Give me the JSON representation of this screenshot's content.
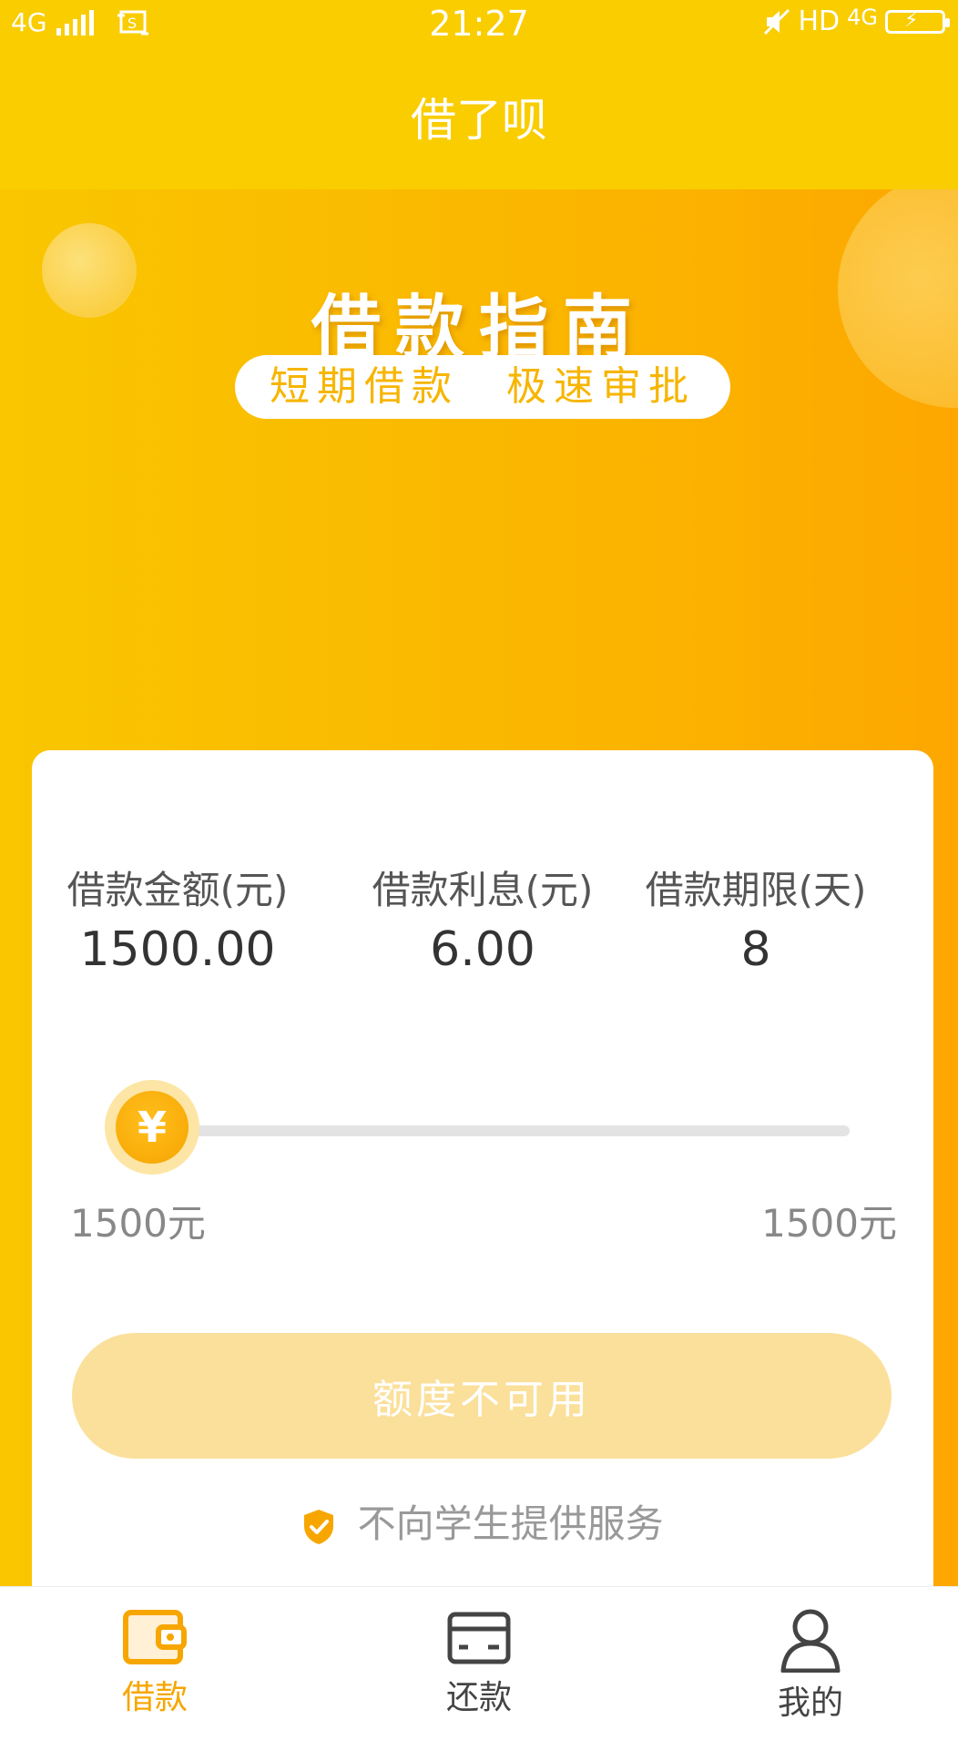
{
  "status_bar": {
    "network_left": "4G",
    "time": "21:27",
    "hd": "HD",
    "network_right": "4G"
  },
  "header": {
    "title": "借了呗"
  },
  "banner": {
    "title": "借款指南",
    "subtitle": "短期借款　极速审批"
  },
  "loan_card": {
    "stats": [
      {
        "label": "借款金额(元)",
        "value": "1500.00"
      },
      {
        "label": "借款利息(元)",
        "value": "6.00"
      },
      {
        "label": "借款期限(天)",
        "value": "8"
      }
    ],
    "slider": {
      "handle_symbol": "¥",
      "min_label": "1500元",
      "max_label": "1500元",
      "level": 0
    },
    "button_label": "额度不可用",
    "notice": "不向学生提供服务"
  },
  "tab_bar": {
    "tabs": [
      {
        "label": "借款",
        "icon": "wallet-icon",
        "active": true
      },
      {
        "label": "还款",
        "icon": "card-icon",
        "active": false
      },
      {
        "label": "我的",
        "icon": "user-icon",
        "active": false
      }
    ]
  },
  "colors": {
    "brand_yellow": "#f9cd00",
    "accent_orange": "#f7a600",
    "disabled_button": "#fbe09b"
  }
}
